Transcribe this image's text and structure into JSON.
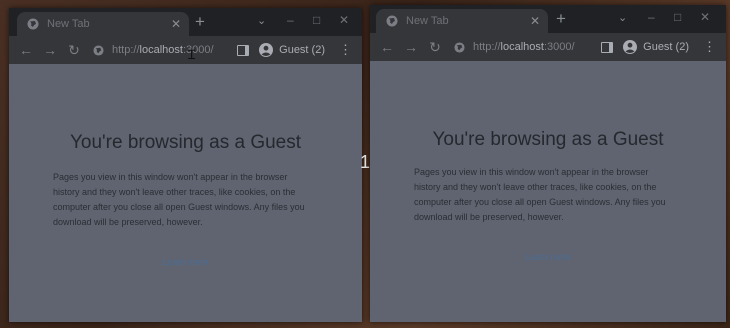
{
  "windows": [
    {
      "tab_title": "New Tab",
      "url_prefix": "http://",
      "url_host": "localhost",
      "url_suffix": ":3000/",
      "profile_label": "Guest (2)",
      "heading": "You're browsing as a Guest",
      "body": "Pages you view in this window won't appear in the browser history and they won't leave other traces, like cookies, on the computer after you close all open Guest windows. Any files you download will be preserved, however.",
      "learn_more": "Learn more"
    },
    {
      "tab_title": "New Tab",
      "url_prefix": "http://",
      "url_host": "localhost",
      "url_suffix": ":3000/",
      "profile_label": "Guest (2)",
      "heading": "You're browsing as a Guest",
      "body": "Pages you view in this window won't appear in the browser history and they won't leave other traces, like cookies, on the computer after you close all open Guest windows. Any files you download will be preserved, however.",
      "learn_more": "Learn more"
    }
  ],
  "overlay_number": "1",
  "icons": {
    "tab_favicon": "globe-icon",
    "tab_close": "close-icon",
    "new_tab": "plus-icon",
    "tab_search": "chevron-down-icon",
    "back": "back-arrow-icon",
    "forward": "forward-arrow-icon",
    "reload": "reload-icon",
    "site_info": "info-icon",
    "side_panel": "side-panel-icon",
    "profile": "account-icon",
    "menu": "kebab-menu-icon",
    "text_cursor": "i-beam-cursor-icon"
  },
  "colors": {
    "page_background": "#5f6470",
    "titlebar": "#1f2124",
    "toolbar": "#35363a",
    "link": "#4b6c94"
  }
}
